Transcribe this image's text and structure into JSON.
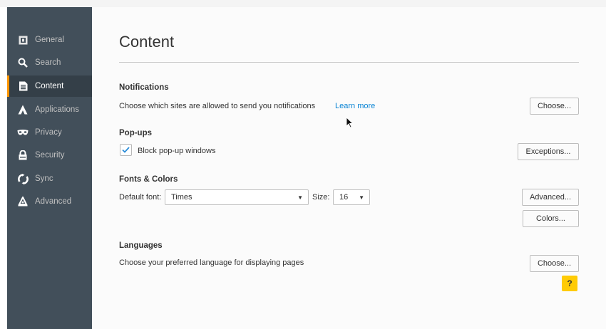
{
  "sidebar": {
    "items": [
      {
        "label": "General",
        "icon": "general-icon"
      },
      {
        "label": "Search",
        "icon": "search-icon"
      },
      {
        "label": "Content",
        "icon": "content-icon",
        "active": true
      },
      {
        "label": "Applications",
        "icon": "applications-icon"
      },
      {
        "label": "Privacy",
        "icon": "privacy-mask-icon"
      },
      {
        "label": "Security",
        "icon": "security-lock-icon"
      },
      {
        "label": "Sync",
        "icon": "sync-icon"
      },
      {
        "label": "Advanced",
        "icon": "advanced-icon"
      }
    ]
  },
  "main": {
    "title": "Content",
    "notifications": {
      "heading": "Notifications",
      "description": "Choose which sites are allowed to send you notifications",
      "learn_more": "Learn more",
      "choose_button": "Choose..."
    },
    "popups": {
      "heading": "Pop-ups",
      "block_label": "Block pop-up windows",
      "block_checked": true,
      "exceptions_button": "Exceptions..."
    },
    "fonts": {
      "heading": "Fonts & Colors",
      "default_font_label": "Default font:",
      "default_font_value": "Times",
      "size_label": "Size:",
      "size_value": "16",
      "advanced_button": "Advanced...",
      "colors_button": "Colors..."
    },
    "languages": {
      "heading": "Languages",
      "description": "Choose your preferred language for displaying pages",
      "choose_button": "Choose..."
    },
    "help_button": "?"
  },
  "colors": {
    "sidebar_bg": "#424f5a",
    "active_accent": "#ff9500",
    "link": "#0a84d4",
    "help_bg": "#ffcb05"
  }
}
